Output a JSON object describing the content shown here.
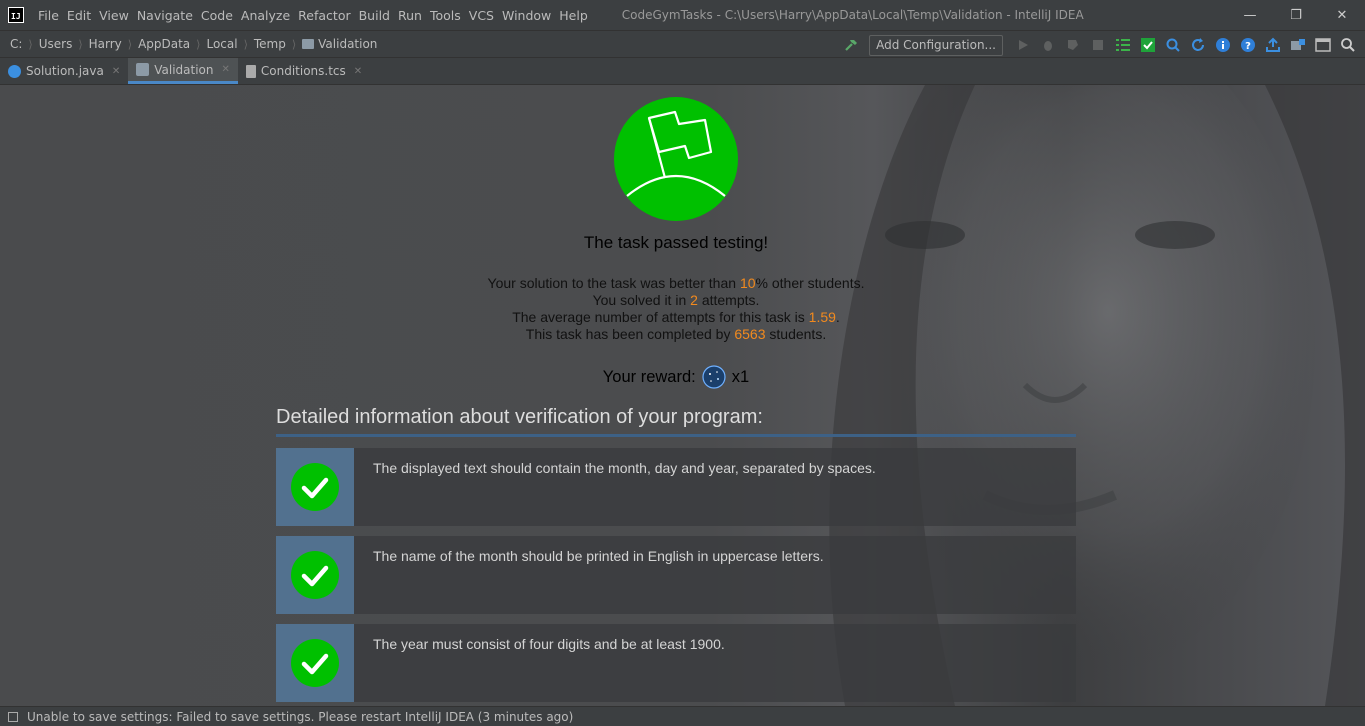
{
  "app": {
    "menu": [
      "File",
      "Edit",
      "View",
      "Navigate",
      "Code",
      "Analyze",
      "Refactor",
      "Build",
      "Run",
      "Tools",
      "VCS",
      "Window",
      "Help"
    ],
    "window_title": "CodeGymTasks - C:\\Users\\Harry\\AppData\\Local\\Temp\\Validation - IntelliJ IDEA",
    "logo_text": "IJ"
  },
  "navbar": {
    "breadcrumbs": [
      "C:",
      "Users",
      "Harry",
      "AppData",
      "Local",
      "Temp",
      "Validation"
    ],
    "add_configuration": "Add Configuration..."
  },
  "tabs": [
    {
      "label": "Solution.java",
      "active": false
    },
    {
      "label": "Validation",
      "active": true
    },
    {
      "label": "Conditions.tcs",
      "active": false
    }
  ],
  "result": {
    "title": "The task passed testing!",
    "line1": {
      "pre": "Your solution to the task was better than ",
      "value": "10",
      "post": "% other students."
    },
    "line2": {
      "pre": "You solved it in ",
      "value": "2",
      "post": " attempts."
    },
    "line3": {
      "pre": "The average number of attempts for this task is ",
      "value": "1.59",
      "post": "."
    },
    "line4": {
      "pre": "This task has been completed by ",
      "value": "6563",
      "post": " students."
    },
    "reward_label": "Your reward:",
    "reward_count": "x1"
  },
  "details": {
    "title": "Detailed information about verification of your program:",
    "checks": [
      {
        "text": "The displayed text should contain the month, day and year, separated by spaces.",
        "passed": true
      },
      {
        "text": "The name of the month should be printed in English in uppercase letters.",
        "passed": true
      },
      {
        "text": "The year must consist of four digits and be at least 1900.",
        "passed": true
      }
    ]
  },
  "status": {
    "message": "Unable to save settings: Failed to save settings. Please restart IntelliJ IDEA (3 minutes ago)"
  },
  "colors": {
    "accent_green": "#00c000",
    "highlight_orange": "#f28a1e",
    "check_box_blue": "#52718f"
  }
}
